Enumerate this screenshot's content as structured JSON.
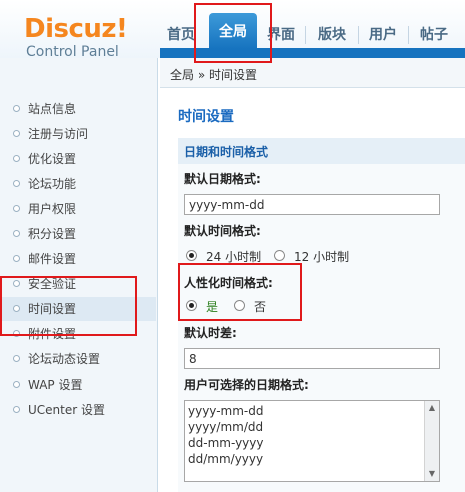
{
  "header": {
    "logo": "Discuz!",
    "logo_sub": "Control Panel",
    "tabs": [
      {
        "label": "首页"
      },
      {
        "label": "全局"
      },
      {
        "label": "界面"
      },
      {
        "label": "版块"
      },
      {
        "label": "用户"
      },
      {
        "label": "帖子"
      }
    ],
    "active_tab": "全局"
  },
  "breadcrumb": "全局 » 时间设置",
  "sidebar": {
    "items": [
      {
        "label": "站点信息"
      },
      {
        "label": "注册与访问"
      },
      {
        "label": "优化设置"
      },
      {
        "label": "论坛功能"
      },
      {
        "label": "用户权限"
      },
      {
        "label": "积分设置"
      },
      {
        "label": "邮件设置"
      },
      {
        "label": "安全验证"
      },
      {
        "label": "时间设置"
      },
      {
        "label": "附件设置"
      },
      {
        "label": "论坛动态设置"
      },
      {
        "label": "WAP 设置"
      },
      {
        "label": "UCenter 设置"
      }
    ],
    "active_item": "时间设置"
  },
  "main": {
    "page_title": "时间设置",
    "section_title": "日期和时间格式",
    "date_format": {
      "label": "默认日期格式:",
      "value": "yyyy-mm-dd"
    },
    "time_format": {
      "label": "默认时间格式:",
      "options": [
        "24 小时制",
        "12 小时制"
      ],
      "selected": "24 小时制"
    },
    "humanized": {
      "label": "人性化时间格式:",
      "options": [
        "是",
        "否"
      ],
      "selected": "是"
    },
    "timezone_offset": {
      "label": "默认时差:",
      "value": "8"
    },
    "user_date_formats": {
      "label": "用户可选择的日期格式:",
      "lines": [
        "yyyy-mm-dd",
        "yyyy/mm/dd",
        "dd-mm-yyyy",
        "dd/mm/yyyy"
      ]
    }
  },
  "colors": {
    "accent": "#1673bf",
    "logo": "#f5861f",
    "highlight": "#e0191b"
  }
}
